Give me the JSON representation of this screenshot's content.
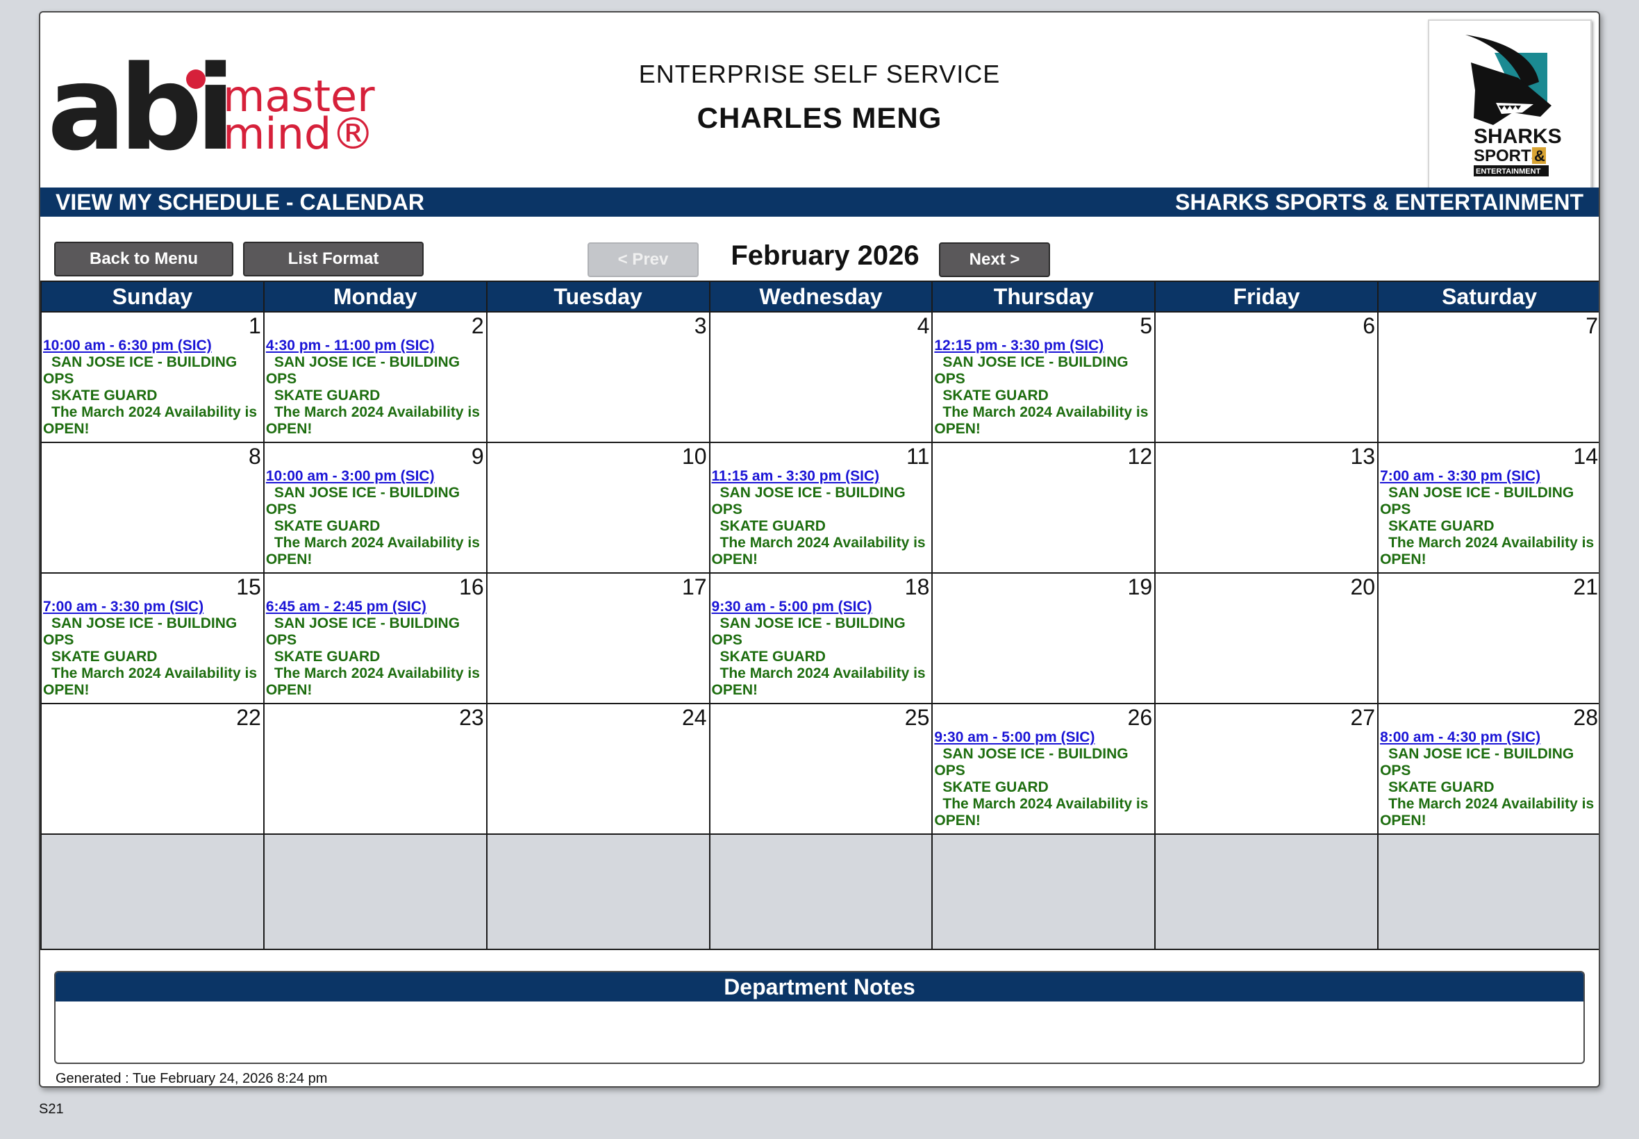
{
  "header": {
    "logo_left_main": "abi",
    "logo_left_sub1": "master",
    "logo_left_sub2": "mind®",
    "app_title": "ENTERPRISE SELF SERVICE",
    "employee_name": "CHARLES MENG",
    "logo_right": {
      "line1": "SHARKS",
      "line2": "SPORTS",
      "amp": "&",
      "line3": "ENTERTAINMENT"
    }
  },
  "title_bar": {
    "left": "VIEW MY SCHEDULE - CALENDAR",
    "right": "SHARKS SPORTS & ENTERTAINMENT"
  },
  "toolbar": {
    "back_label": "Back to Menu",
    "list_label": "List Format",
    "prev_label": "< Prev",
    "next_label": "Next >",
    "month_title": "February 2026"
  },
  "calendar": {
    "day_headers": [
      "Sunday",
      "Monday",
      "Tuesday",
      "Wednesday",
      "Thursday",
      "Friday",
      "Saturday"
    ],
    "weeks": [
      [
        {
          "day": "1",
          "shift": {
            "time": "10:00 am - 6:30 pm (SIC)",
            "location": "SAN JOSE ICE - BUILDING",
            "location_cont": "OPS",
            "position": "SKATE GUARD",
            "note": "The March 2024 Availability is",
            "note_cont": "OPEN!"
          }
        },
        {
          "day": "2",
          "shift": {
            "time": "4:30 pm - 11:00 pm (SIC)",
            "location": "SAN JOSE ICE - BUILDING",
            "location_cont": "OPS",
            "position": "SKATE GUARD",
            "note": "The March 2024 Availability is",
            "note_cont": "OPEN!"
          }
        },
        {
          "day": "3"
        },
        {
          "day": "4"
        },
        {
          "day": "5",
          "shift": {
            "time": "12:15 pm - 3:30 pm (SIC)",
            "location": "SAN JOSE ICE - BUILDING",
            "location_cont": "OPS",
            "position": "SKATE GUARD",
            "note": "The March 2024 Availability is",
            "note_cont": "OPEN!"
          }
        },
        {
          "day": "6"
        },
        {
          "day": "7"
        }
      ],
      [
        {
          "day": "8"
        },
        {
          "day": "9",
          "shift": {
            "time": "10:00 am - 3:00 pm (SIC)",
            "location": "SAN JOSE ICE - BUILDING",
            "location_cont": "OPS",
            "position": "SKATE GUARD",
            "note": "The March 2024 Availability is",
            "note_cont": "OPEN!"
          }
        },
        {
          "day": "10"
        },
        {
          "day": "11",
          "shift": {
            "time": "11:15 am - 3:30 pm (SIC)",
            "location": "SAN JOSE ICE - BUILDING",
            "location_cont": "OPS",
            "position": "SKATE GUARD",
            "note": "The March 2024 Availability is",
            "note_cont": "OPEN!"
          }
        },
        {
          "day": "12"
        },
        {
          "day": "13"
        },
        {
          "day": "14",
          "shift": {
            "time": "7:00 am - 3:30 pm (SIC)",
            "location": "SAN JOSE ICE - BUILDING",
            "location_cont": "OPS",
            "position": "SKATE GUARD",
            "note": "The March 2024 Availability is",
            "note_cont": "OPEN!"
          }
        }
      ],
      [
        {
          "day": "15",
          "shift": {
            "time": "7:00 am - 3:30 pm (SIC)",
            "location": "SAN JOSE ICE - BUILDING",
            "location_cont": "OPS",
            "position": "SKATE GUARD",
            "note": "The March 2024 Availability is",
            "note_cont": "OPEN!"
          }
        },
        {
          "day": "16",
          "shift": {
            "time": "6:45 am - 2:45 pm (SIC)",
            "location": "SAN JOSE ICE - BUILDING",
            "location_cont": "OPS",
            "position": "SKATE GUARD",
            "note": "The March 2024 Availability is",
            "note_cont": "OPEN!"
          }
        },
        {
          "day": "17"
        },
        {
          "day": "18",
          "shift": {
            "time": "9:30 am - 5:00 pm (SIC)",
            "location": "SAN JOSE ICE - BUILDING",
            "location_cont": "OPS",
            "position": "SKATE GUARD",
            "note": "The March 2024 Availability is",
            "note_cont": "OPEN!"
          }
        },
        {
          "day": "19"
        },
        {
          "day": "20"
        },
        {
          "day": "21"
        }
      ],
      [
        {
          "day": "22"
        },
        {
          "day": "23"
        },
        {
          "day": "24"
        },
        {
          "day": "25"
        },
        {
          "day": "26",
          "shift": {
            "time": "9:30 am - 5:00 pm (SIC)",
            "location": "SAN JOSE ICE - BUILDING",
            "location_cont": "OPS",
            "position": "SKATE GUARD",
            "note": "The March 2024 Availability is",
            "note_cont": "OPEN!"
          }
        },
        {
          "day": "27"
        },
        {
          "day": "28",
          "shift": {
            "time": "8:00 am - 4:30 pm (SIC)",
            "location": "SAN JOSE ICE - BUILDING",
            "location_cont": "OPS",
            "position": "SKATE GUARD",
            "note": "The March 2024 Availability is",
            "note_cont": "OPEN!"
          }
        }
      ]
    ]
  },
  "notes": {
    "title": "Department Notes",
    "body": ""
  },
  "footer": {
    "generated": "Generated : Tue February 24, 2026 8:24 pm",
    "code": "S21"
  },
  "colors": {
    "navy": "#0b3566",
    "link": "#1a14d6",
    "green_text": "#1d6d0f",
    "brand_red": "#d6203a",
    "teal": "#1b8a92",
    "gold": "#d9a432"
  }
}
